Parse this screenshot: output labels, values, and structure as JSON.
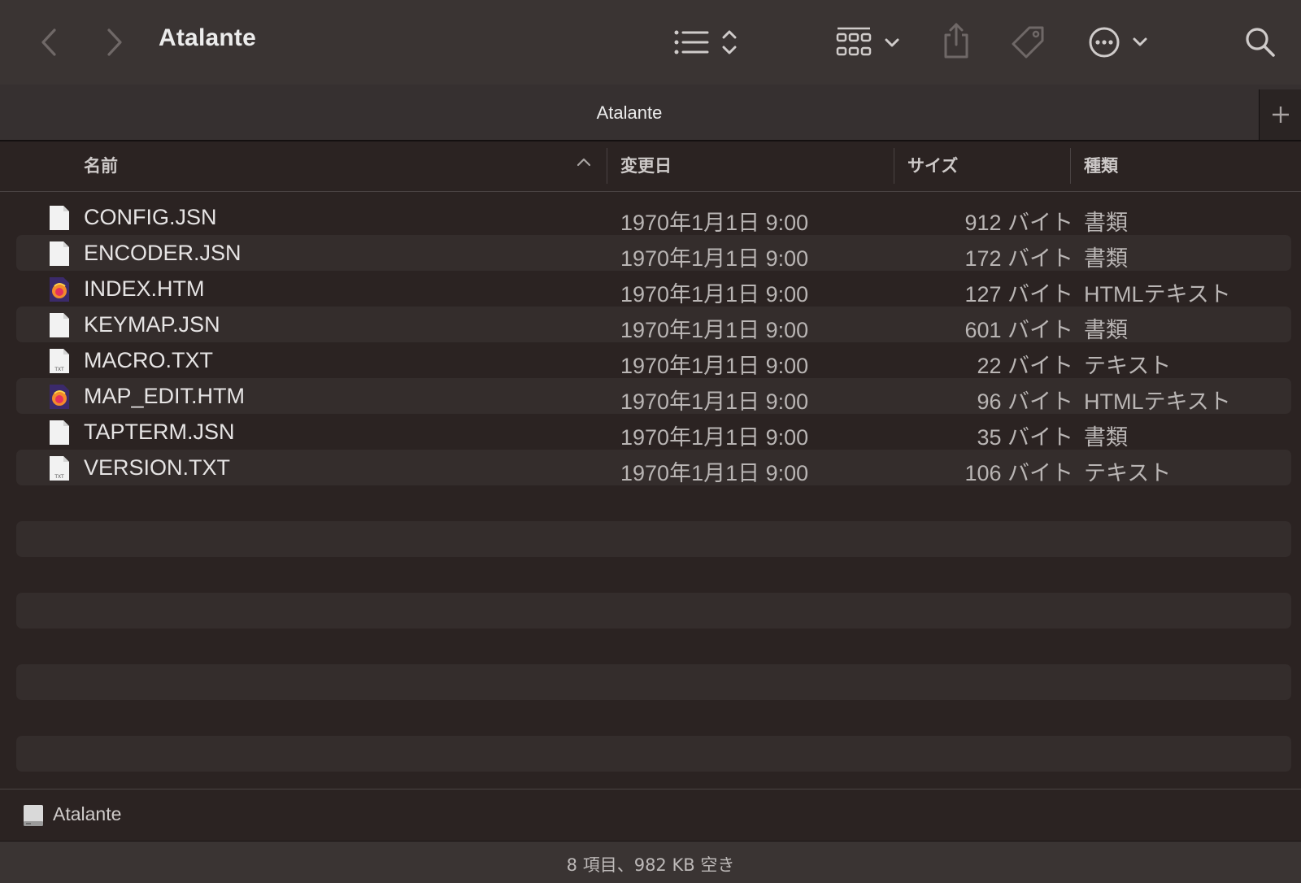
{
  "window": {
    "title": "Atalante"
  },
  "toolbar": {
    "back_icon": "chevron-left-icon",
    "forward_icon": "chevron-right-icon",
    "view_icon": "list-view-icon",
    "group_icon": "group-grid-icon",
    "share_icon": "share-icon",
    "tag_icon": "tag-icon",
    "more_icon": "ellipsis-circle-icon",
    "search_icon": "search-icon"
  },
  "tab": {
    "title": "Atalante",
    "new_tab_icon": "plus-icon"
  },
  "columns": {
    "name": "名前",
    "date": "変更日",
    "size": "サイズ",
    "kind": "種類",
    "sort_icon": "chevron-up-icon"
  },
  "files": [
    {
      "name": "CONFIG.JSN",
      "date": "1970年1月1日 9:00",
      "size": "912 バイト",
      "kind": "書類",
      "icon": "document"
    },
    {
      "name": "ENCODER.JSN",
      "date": "1970年1月1日 9:00",
      "size": "172 バイト",
      "kind": "書類",
      "icon": "document"
    },
    {
      "name": "INDEX.HTM",
      "date": "1970年1月1日 9:00",
      "size": "127 バイト",
      "kind": "HTMLテキスト",
      "icon": "browser-html"
    },
    {
      "name": "KEYMAP.JSN",
      "date": "1970年1月1日 9:00",
      "size": "601 バイト",
      "kind": "書類",
      "icon": "document"
    },
    {
      "name": "MACRO.TXT",
      "date": "1970年1月1日 9:00",
      "size": "22 バイト",
      "kind": "テキスト",
      "icon": "text"
    },
    {
      "name": "MAP_EDIT.HTM",
      "date": "1970年1月1日 9:00",
      "size": "96 バイト",
      "kind": "HTMLテキスト",
      "icon": "browser-html"
    },
    {
      "name": "TAPTERM.JSN",
      "date": "1970年1月1日 9:00",
      "size": "35 バイト",
      "kind": "書類",
      "icon": "document"
    },
    {
      "name": "VERSION.TXT",
      "date": "1970年1月1日 9:00",
      "size": "106 バイト",
      "kind": "テキスト",
      "icon": "text"
    }
  ],
  "txt_badge": "TXT",
  "pathbar": {
    "label": "Atalante",
    "icon": "external-drive-icon"
  },
  "status": {
    "text": "8 項目、982 KB 空き"
  },
  "colors": {
    "background": "#2b2322",
    "toolbar": "#3a3433",
    "alt_row": "#342d2c",
    "text": "#e6e4e4",
    "secondary_text": "#b9b5b4"
  }
}
